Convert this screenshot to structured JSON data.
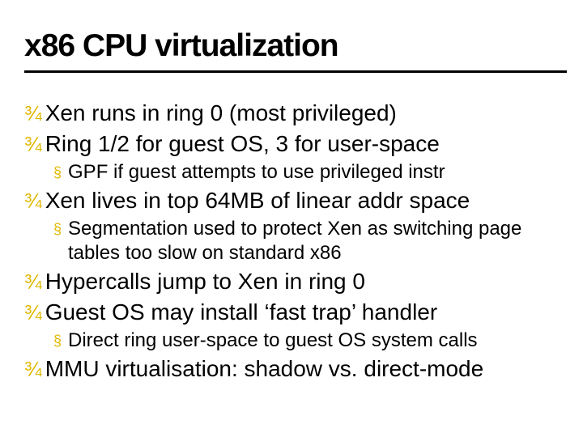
{
  "title": "x86 CPU virtualization",
  "bullets": {
    "b0": "Xen runs in ring 0 (most privileged)",
    "b1": "Ring 1/2 for guest OS, 3 for user-space",
    "b1s0": "GPF if guest attempts to use privileged instr",
    "b2": "Xen lives in top 64MB of linear addr space",
    "b2s0": "Segmentation used to protect Xen as switching page tables too slow on standard x86",
    "b3": "Hypercalls jump to Xen in ring 0",
    "b4": "Guest OS may install ‘fast trap’ handler",
    "b4s0": "Direct ring user-space to guest OS system calls",
    "b5": "MMU virtualisation: shadow vs. direct-mode"
  },
  "marks": {
    "l1": "¾",
    "l2": "§"
  }
}
